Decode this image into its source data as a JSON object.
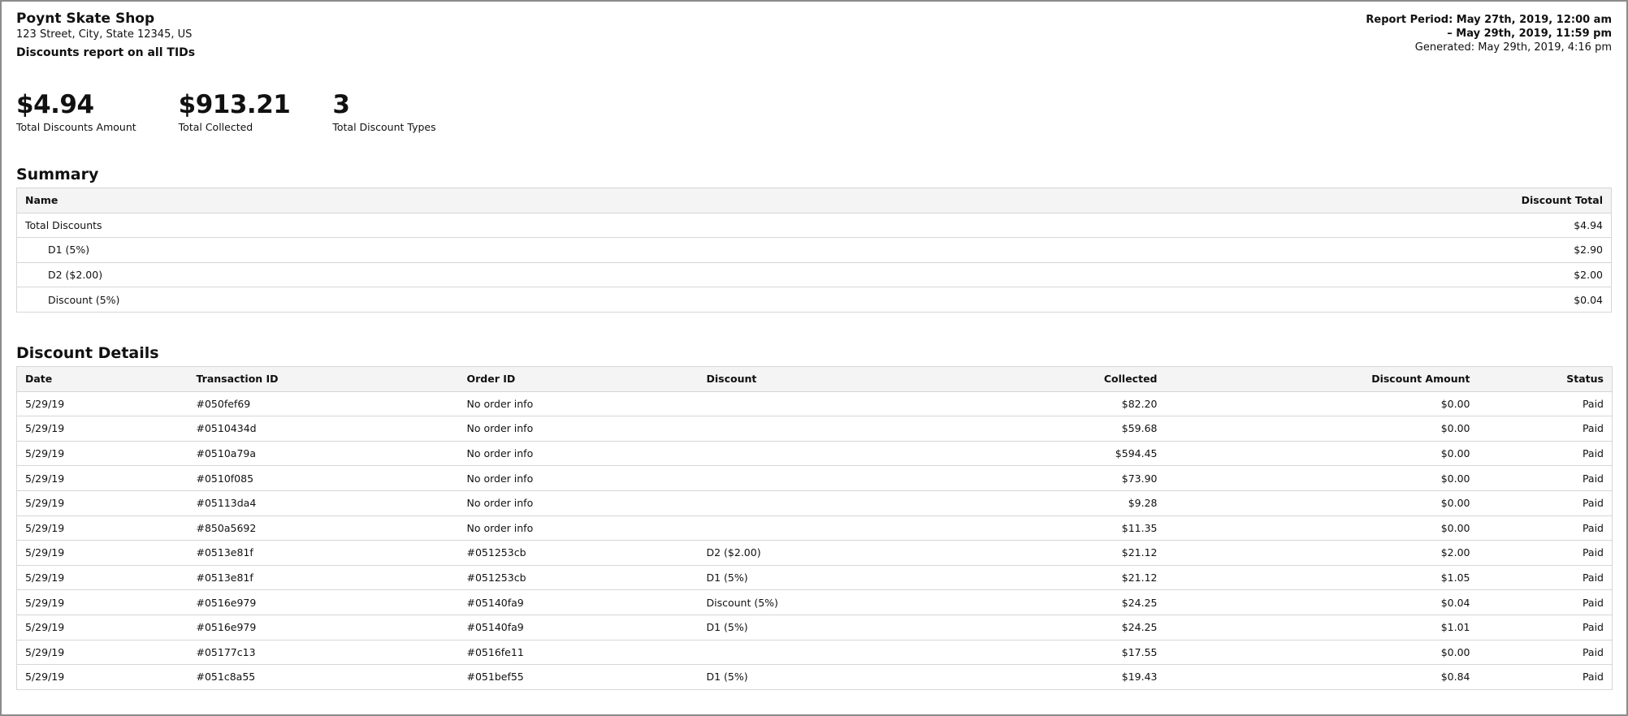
{
  "header": {
    "shop_name": "Poynt Skate Shop",
    "address": "123 Street, City, State 12345, US",
    "report_title": "Discounts report on all TIDs",
    "period_line1": "Report Period: May 27th, 2019, 12:00 am",
    "period_line2": "– May 29th, 2019, 11:59 pm",
    "generated": "Generated: May 29th, 2019, 4:16 pm"
  },
  "kpis": [
    {
      "value": "$4.94",
      "label": "Total Discounts Amount"
    },
    {
      "value": "$913.21",
      "label": "Total Collected"
    },
    {
      "value": "3",
      "label": "Total Discount Types"
    }
  ],
  "summary": {
    "title": "Summary",
    "columns": {
      "name": "Name",
      "total": "Discount Total"
    },
    "rows": [
      {
        "name": "Total Discounts",
        "total": "$4.94"
      },
      {
        "name": "D1 (5%)",
        "total": "$2.90"
      },
      {
        "name": "D2 ($2.00)",
        "total": "$2.00"
      },
      {
        "name": "Discount (5%)",
        "total": "$0.04"
      }
    ]
  },
  "details": {
    "title": "Discount Details",
    "columns": {
      "date": "Date",
      "transaction_id": "Transaction ID",
      "order_id": "Order ID",
      "discount": "Discount",
      "collected": "Collected",
      "discount_amount": "Discount Amount",
      "status": "Status"
    },
    "rows": [
      {
        "date": "5/29/19",
        "transaction_id": "#050fef69",
        "order_id": "No order info",
        "discount": "",
        "collected": "$82.20",
        "discount_amount": "$0.00",
        "status": "Paid"
      },
      {
        "date": "5/29/19",
        "transaction_id": "#0510434d",
        "order_id": "No order info",
        "discount": "",
        "collected": "$59.68",
        "discount_amount": "$0.00",
        "status": "Paid"
      },
      {
        "date": "5/29/19",
        "transaction_id": "#0510a79a",
        "order_id": "No order info",
        "discount": "",
        "collected": "$594.45",
        "discount_amount": "$0.00",
        "status": "Paid"
      },
      {
        "date": "5/29/19",
        "transaction_id": "#0510f085",
        "order_id": "No order info",
        "discount": "",
        "collected": "$73.90",
        "discount_amount": "$0.00",
        "status": "Paid"
      },
      {
        "date": "5/29/19",
        "transaction_id": "#05113da4",
        "order_id": "No order info",
        "discount": "",
        "collected": "$9.28",
        "discount_amount": "$0.00",
        "status": "Paid"
      },
      {
        "date": "5/29/19",
        "transaction_id": "#850a5692",
        "order_id": "No order info",
        "discount": "",
        "collected": "$11.35",
        "discount_amount": "$0.00",
        "status": "Paid"
      },
      {
        "date": "5/29/19",
        "transaction_id": "#0513e81f",
        "order_id": "#051253cb",
        "discount": "D2 ($2.00)",
        "collected": "$21.12",
        "discount_amount": "$2.00",
        "status": "Paid"
      },
      {
        "date": "5/29/19",
        "transaction_id": "#0513e81f",
        "order_id": "#051253cb",
        "discount": "D1 (5%)",
        "collected": "$21.12",
        "discount_amount": "$1.05",
        "status": "Paid"
      },
      {
        "date": "5/29/19",
        "transaction_id": "#0516e979",
        "order_id": "#05140fa9",
        "discount": "Discount (5%)",
        "collected": "$24.25",
        "discount_amount": "$0.04",
        "status": "Paid"
      },
      {
        "date": "5/29/19",
        "transaction_id": "#0516e979",
        "order_id": "#05140fa9",
        "discount": "D1 (5%)",
        "collected": "$24.25",
        "discount_amount": "$1.01",
        "status": "Paid"
      },
      {
        "date": "5/29/19",
        "transaction_id": "#05177c13",
        "order_id": "#0516fe11",
        "discount": "",
        "collected": "$17.55",
        "discount_amount": "$0.00",
        "status": "Paid"
      },
      {
        "date": "5/29/19",
        "transaction_id": "#051c8a55",
        "order_id": "#051bef55",
        "discount": "D1 (5%)",
        "collected": "$19.43",
        "discount_amount": "$0.84",
        "status": "Paid"
      }
    ]
  }
}
